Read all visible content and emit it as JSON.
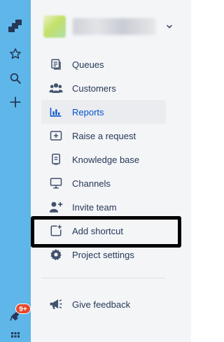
{
  "global_nav": {
    "logo_icon": "jira-logo-icon",
    "icons": [
      "jira-logo-icon",
      "star-icon",
      "search-icon",
      "plus-icon",
      "megaphone-notification-icon",
      "app-switcher-icon"
    ],
    "notification_badge": "9+",
    "background_color": "#5fb6e8",
    "badge_color": "#e5492b"
  },
  "project": {
    "name": "",
    "chevron_icon": "chevron-down-icon"
  },
  "sidebar": {
    "items": [
      {
        "label": "Queues",
        "icon": "queues-icon",
        "selected": false
      },
      {
        "label": "Customers",
        "icon": "customers-icon",
        "selected": false
      },
      {
        "label": "Reports",
        "icon": "reports-icon",
        "selected": true
      },
      {
        "label": "Raise a request",
        "icon": "raise-request-icon",
        "selected": false
      },
      {
        "label": "Knowledge base",
        "icon": "knowledge-base-icon",
        "selected": false
      },
      {
        "label": "Channels",
        "icon": "channels-icon",
        "selected": false
      },
      {
        "label": "Invite team",
        "icon": "invite-team-icon",
        "selected": false
      },
      {
        "label": "Add shortcut",
        "icon": "add-shortcut-icon",
        "selected": false,
        "highlighted": true
      },
      {
        "label": "Project settings",
        "icon": "gear-icon",
        "selected": false
      }
    ],
    "footer": {
      "label": "Give feedback",
      "icon": "megaphone-icon"
    }
  },
  "colors": {
    "selected_text": "#0052cc",
    "text": "#253858",
    "sidebar_bg": "#f4f5f7",
    "highlight_border": "#000000"
  }
}
